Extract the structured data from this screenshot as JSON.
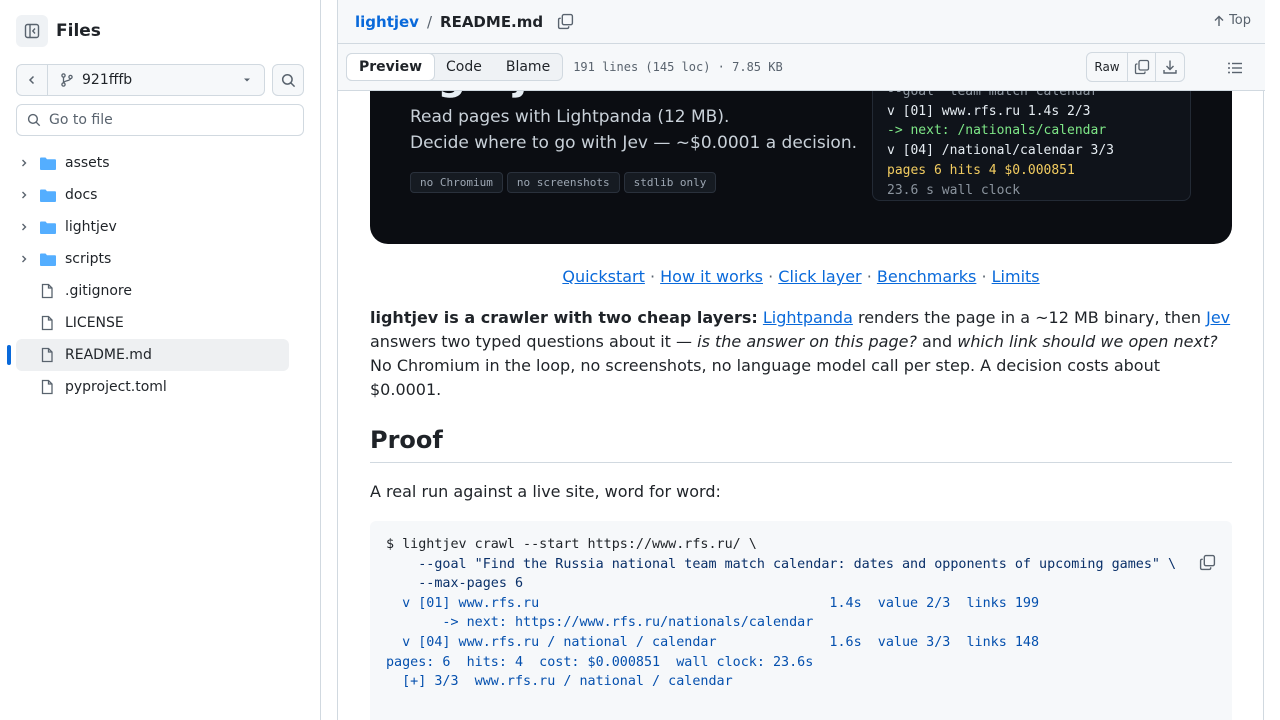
{
  "sidebar": {
    "title": "Files",
    "branch": "921fffb",
    "goto_placeholder": "Go to file",
    "items": [
      {
        "label": "assets",
        "type": "folder"
      },
      {
        "label": "docs",
        "type": "folder"
      },
      {
        "label": "lightjev",
        "type": "folder"
      },
      {
        "label": "scripts",
        "type": "folder"
      },
      {
        "label": ".gitignore",
        "type": "file"
      },
      {
        "label": "LICENSE",
        "type": "file"
      },
      {
        "label": "README.md",
        "type": "file",
        "active": true
      },
      {
        "label": "pyproject.toml",
        "type": "file"
      }
    ]
  },
  "header": {
    "repo": "lightjev",
    "sep": "/",
    "file": "README.md",
    "top_label": "Top"
  },
  "toolbar": {
    "tabs": [
      "Preview",
      "Code",
      "Blame"
    ],
    "meta": "191 lines (145 loc) · 7.85 KB",
    "raw_label": "Raw"
  },
  "hero": {
    "big": "lightjev",
    "line1": "Read pages with Lightpanda (12 MB).",
    "line2": "Decide where to go with Jev — ~$0.0001 a decision.",
    "tags": [
      "no Chromium",
      "no screenshots",
      "stdlib only"
    ],
    "terminal": [
      "--goal \"team match calendar\"",
      "v [01] www.rfs.ru 1.4s 2/3",
      "-> next: /nationals/calendar",
      "v [04] /national/calendar 3/3",
      "pages 6 hits 4 $0.000851",
      "23.6 s wall clock"
    ]
  },
  "nav_links": [
    "Quickstart",
    "How it works",
    "Click layer",
    "Benchmarks",
    "Limits"
  ],
  "intro": {
    "bold": "lightjev is a crawler with two cheap layers:",
    "link1": "Lightpanda",
    "t1": " renders the page in a ~12 MB binary, then ",
    "link2": "Jev",
    "t2": " answers two typed questions about it — ",
    "q1": "is the answer on this page?",
    "t3": " and ",
    "q2": "which link should we open next?",
    "t4": " No Chromium in the loop, no screenshots, no language model call per step. A decision costs about $0.0001."
  },
  "proof": {
    "heading": "Proof",
    "sub": "A real run against a live site, word for word:",
    "code": [
      "$ lightjev crawl --start https://www.rfs.ru/ \\",
      "    --goal \"Find the Russia national team match calendar: dates and opponents of upcoming games\" \\",
      "    --max-pages 6",
      "",
      "  v [01] www.rfs.ru                                    1.4s  value 2/3  links 199",
      "       -> next: https://www.rfs.ru/nationals/calendar",
      "  v [04] www.rfs.ru / national / calendar              1.6s  value 3/3  links 148",
      "",
      "pages: 6  hits: 4  cost: $0.000851  wall clock: 23.6s",
      "  [+] 3/3  www.rfs.ru / national / calendar"
    ]
  }
}
